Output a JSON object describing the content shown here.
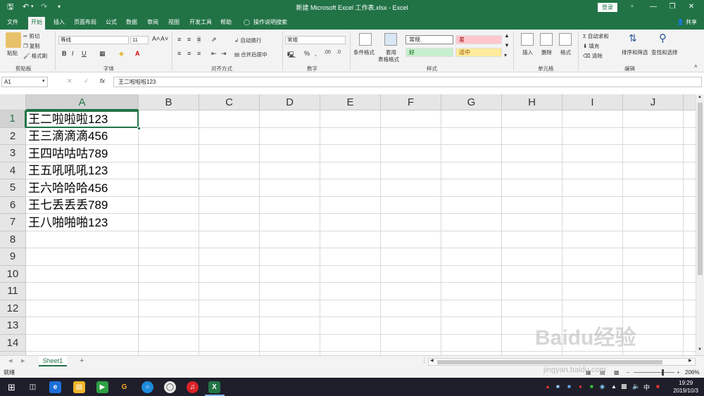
{
  "window": {
    "title": "新建 Microsoft Excel 工作表.xlsx  -  Excel",
    "login": "登录"
  },
  "tabs": [
    "文件",
    "开始",
    "插入",
    "页面布局",
    "公式",
    "数据",
    "审阅",
    "视图",
    "开发工具",
    "帮助"
  ],
  "active_tab": "开始",
  "search_hint": "操作说明搜索",
  "share": "共享",
  "ribbon": {
    "clipboard": {
      "label": "剪贴板",
      "paste": "粘贴",
      "cut": "剪切",
      "copy": "复制",
      "format_painter": "格式刷"
    },
    "font": {
      "label": "字体",
      "name": "等线",
      "size": "11"
    },
    "alignment": {
      "label": "对齐方式",
      "wrap": "自动换行",
      "merge": "合并后居中"
    },
    "number": {
      "label": "数字",
      "format": "常规"
    },
    "styles": {
      "label": "样式",
      "conditional": "条件格式",
      "table": "套用",
      "table2": "表格格式",
      "cells": [
        {
          "name": "常规",
          "color": "#ffffff"
        },
        {
          "name": "差",
          "color": "#ffc7ce"
        },
        {
          "name": "好",
          "color": "#c6efce"
        },
        {
          "name": "适中",
          "color": "#ffeb9c"
        }
      ]
    },
    "cells": {
      "label": "单元格",
      "insert": "插入",
      "delete": "删除",
      "format": "格式"
    },
    "editing": {
      "label": "编辑",
      "autosum": "自动求和",
      "fill": "填充",
      "clear": "清除",
      "sort": "排序和筛选",
      "find": "查找和选择"
    }
  },
  "formula_bar": {
    "name_box": "A1",
    "content": "王二啦啦啦123"
  },
  "columns": [
    "A",
    "B",
    "C",
    "D",
    "E",
    "F",
    "G",
    "H",
    "I",
    "J"
  ],
  "rows": [
    "1",
    "2",
    "3",
    "4",
    "5",
    "6",
    "7",
    "8",
    "9",
    "10",
    "11",
    "12",
    "13",
    "14"
  ],
  "cells_A": [
    "王二啦啦啦123",
    "王三滴滴滴456",
    "王四咕咕咕789",
    "王五吼吼吼123",
    "王六哈哈哈456",
    "王七丢丢丢789",
    "王八啪啪啪123"
  ],
  "sheet": {
    "name": "Sheet1",
    "add": "+"
  },
  "status": {
    "ready": "就绪",
    "zoom": "206%"
  },
  "taskbar": {
    "time": "19:29",
    "date": "2019/10/3",
    "ime": "中"
  },
  "watermark": {
    "main": "Baidu经验",
    "sub": "jingyan.baidu.com"
  },
  "colors": {
    "accent": "#217346",
    "taskbar": "#1f1f2b"
  }
}
